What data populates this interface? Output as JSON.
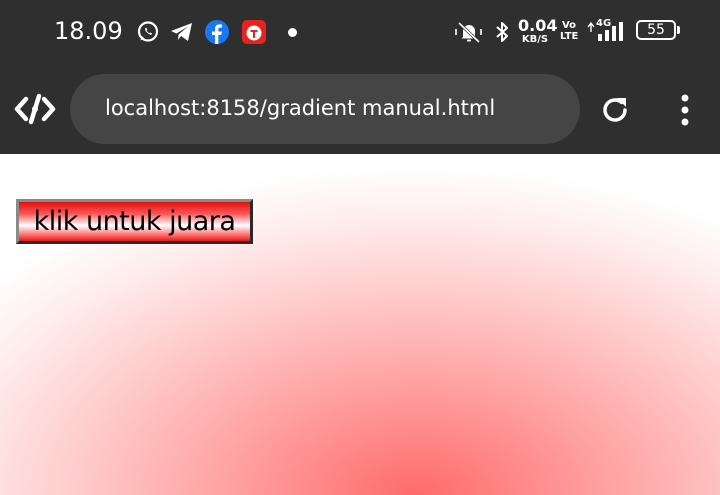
{
  "status_bar": {
    "time": "18.09",
    "network_speed_value": "0.04",
    "network_speed_unit": "KB/S",
    "volte_line1": "Vo",
    "volte_line2": "LTE",
    "network_type": "4G",
    "battery_level": "55",
    "icons": [
      "whatsapp-icon",
      "telegram-icon",
      "facebook-icon",
      "app-notification-icon",
      "more-notifications-dot",
      "mute-vibrate-icon",
      "bluetooth-icon",
      "signal-icon",
      "battery-icon"
    ]
  },
  "browser": {
    "url": "localhost:8158/gradient manual.html",
    "icons": [
      "dev-tools-icon",
      "reload-icon",
      "overflow-menu-icon"
    ]
  },
  "page": {
    "button_label": "klik untuk juara",
    "colors": {
      "gradient_center": "#ff6b6b",
      "gradient_edge": "#ffffff",
      "button_red": "#e01010"
    }
  }
}
